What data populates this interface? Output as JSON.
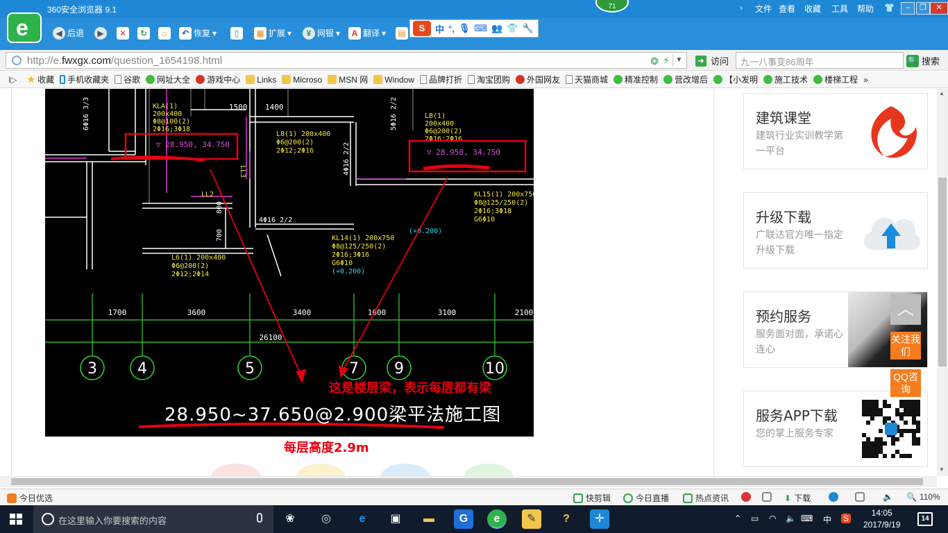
{
  "browser": {
    "title": "360安全浏览器 9.1",
    "notif_count": "71",
    "menu": [
      "文件",
      "查看",
      "收藏",
      "工具",
      "帮助"
    ],
    "toolbar": {
      "back": "后退",
      "restore": "恢复",
      "extend": "扩展",
      "bank": "网银",
      "translate": "翻译"
    },
    "ime": {
      "mode": "中"
    },
    "url_prefix": "http://e.",
    "url_host": "fwxgx.com",
    "url_path": "/question_1654198.html",
    "visit_label": "访问",
    "search_placeholder": "九一八事变86周年",
    "search_label": "搜索",
    "favorites": [
      {
        "label": "收藏",
        "icon": "star-icon"
      },
      {
        "label": "手机收藏夹",
        "icon": "mobile-icon"
      },
      {
        "label": "谷歌",
        "icon": "page-icon"
      },
      {
        "label": "网址大全",
        "icon": "green-icon"
      },
      {
        "label": "游戏中心",
        "icon": "red-icon"
      },
      {
        "label": "Links",
        "icon": "folder-icon"
      },
      {
        "label": "Microso",
        "icon": "folder-icon"
      },
      {
        "label": "MSN 网",
        "icon": "folder-icon"
      },
      {
        "label": "Window",
        "icon": "folder-icon"
      },
      {
        "label": "品牌打折",
        "icon": "page-icon"
      },
      {
        "label": "淘宝团购",
        "icon": "page-icon"
      },
      {
        "label": "外国网友",
        "icon": "red-icon"
      },
      {
        "label": "天猫商城",
        "icon": "page-icon"
      },
      {
        "label": "精准控制",
        "icon": "green-icon"
      },
      {
        "label": "营改增后",
        "icon": "green-icon"
      },
      {
        "label": "【小发明",
        "icon": "green-icon"
      },
      {
        "label": "施工技术",
        "icon": "green-icon"
      },
      {
        "label": "楼梯工程",
        "icon": "green-icon"
      }
    ]
  },
  "drawing": {
    "beam_labels": {
      "kl_a": [
        "KLA(1)",
        "200x400",
        "Φ8@100(2)",
        "2Φ16;3Φ18"
      ],
      "lb1": [
        "LB(1)",
        "200x400",
        "Φ6@200(2)",
        "2Φ16;2Φ16"
      ],
      "l8": [
        "L8(1) 200x400",
        "Φ6@200(2)",
        "2Φ12;2Φ16"
      ],
      "kl15": [
        "KL15(1) 200x750",
        "Φ8@125/250(2)",
        "2Φ16;3Φ18",
        "G6Φ10",
        "(+0.200)"
      ],
      "kl14": [
        "KL14(1) 200x750",
        "Φ8@125/250(2)",
        "2Φ16;3Φ16",
        "G6Φ10",
        "(+0.200)"
      ],
      "l6": [
        "L6(1) 200x400",
        "Φ6@200(2)",
        "2Φ12;2Φ14"
      ]
    },
    "elev_left": "▽ 28.950, 34.750",
    "elev_right": "▽ 28.950, 34.750",
    "dims_top": [
      "1500",
      "1400"
    ],
    "dims": [
      "1700",
      "3600",
      "3400",
      "1600",
      "3100",
      "2100"
    ],
    "total_dim": "26100",
    "axes": [
      "3",
      "4",
      "5",
      "7",
      "9",
      "10"
    ],
    "sheet_title": "28.950~37.650@2.900梁平法施工图",
    "misc_labels": [
      "LL2",
      "LL3",
      "800",
      "700",
      "4Φ16 2/2",
      "4Φ16 2/2",
      "5Φ16 2/2",
      "6Φ16 3/3"
    ]
  },
  "annotations": {
    "note1": "这是楼层梁，表示每层都有梁",
    "note2": "每层高度2.9m"
  },
  "sidebar": [
    {
      "title": "建筑课堂",
      "desc": "建筑行业实训教学第一平台"
    },
    {
      "title": "升级下载",
      "desc": "广联达官方唯一指定升级下载"
    },
    {
      "title": "预约服务",
      "desc": "服务面对面，承诺心连心"
    },
    {
      "title": "服务APP下载",
      "desc": "您的掌上服务专家"
    }
  ],
  "side_tools": {
    "follow": "关注我们",
    "qq": "QQ咨询"
  },
  "statusbar": {
    "left": "今日优选",
    "quickclip": "快剪辑",
    "live": "今日直播",
    "news": "热点资讯",
    "download": "下载",
    "zoom": "110%"
  },
  "taskbar": {
    "search_placeholder": "在这里输入你要搜索的内容",
    "ime": "中",
    "time": "14:05",
    "date": "2017/9/19",
    "notifications": "14"
  }
}
